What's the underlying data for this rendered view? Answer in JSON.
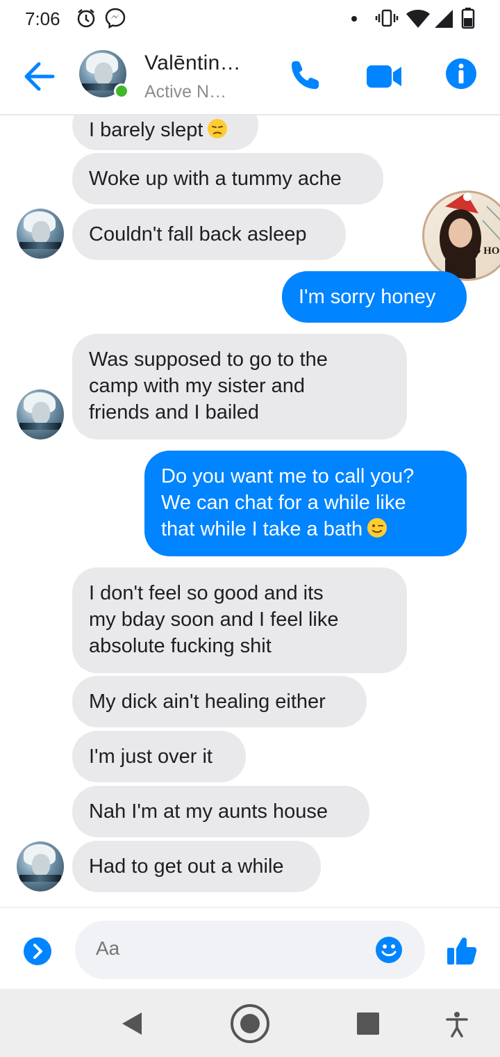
{
  "status_bar": {
    "time": "7:06",
    "icons": [
      "alarm-icon",
      "messenger-icon",
      "notification-dot-icon",
      "vibrate-icon",
      "wifi-icon",
      "signal-icon",
      "battery-icon"
    ]
  },
  "header": {
    "contact_name": "Valēntin…",
    "contact_status": "Active N…",
    "online": true,
    "actions": [
      "phone-icon",
      "video-icon",
      "info-icon"
    ],
    "accent_color": "#0084ff"
  },
  "messages": [
    {
      "id": "m1",
      "direction": "incoming",
      "text": "I barely slept",
      "emoji": "disappointed-face",
      "show_avatar": false
    },
    {
      "id": "m2",
      "direction": "incoming",
      "text": "Woke up with a tummy ache",
      "show_avatar": false
    },
    {
      "id": "m3",
      "direction": "incoming",
      "text": "Couldn't fall back asleep",
      "show_avatar": true
    },
    {
      "id": "m4",
      "direction": "outgoing",
      "text": "I'm sorry honey"
    },
    {
      "id": "m5",
      "direction": "incoming",
      "lines": [
        "Was supposed to go to the",
        "camp with my sister and",
        "friends and I bailed"
      ],
      "show_avatar": true
    },
    {
      "id": "m6",
      "direction": "outgoing",
      "lines": [
        "Do you want me to call you?",
        "We can chat for a while like",
        "that while I take a bath"
      ],
      "emoji": "winking-face"
    },
    {
      "id": "m7",
      "direction": "incoming",
      "lines": [
        "I don't feel so good and its",
        "my bday soon and I feel like",
        "absolute fucking shit"
      ],
      "show_avatar": false
    },
    {
      "id": "m8",
      "direction": "incoming",
      "text": "My dick ain't healing either",
      "show_avatar": false
    },
    {
      "id": "m9",
      "direction": "incoming",
      "text": "I'm just over it",
      "show_avatar": false
    },
    {
      "id": "m10",
      "direction": "incoming",
      "text": "Nah I'm at my aunts house",
      "show_avatar": false
    },
    {
      "id": "m11",
      "direction": "incoming",
      "text": "Had to get out a while",
      "show_avatar": true
    }
  ],
  "chat_head": {
    "caption": "HO HO H"
  },
  "composer": {
    "placeholder": "Aa",
    "icons": [
      "expand-icon",
      "emoji-icon",
      "thumbs-up-icon"
    ]
  },
  "nav_bar": {
    "buttons": [
      "back-nav-icon",
      "home-nav-icon",
      "recents-nav-icon",
      "accessibility-icon"
    ]
  },
  "colors": {
    "incoming_bubble": "#e9e9eb",
    "outgoing_bubble": "#0084ff",
    "online": "#42b72a"
  }
}
